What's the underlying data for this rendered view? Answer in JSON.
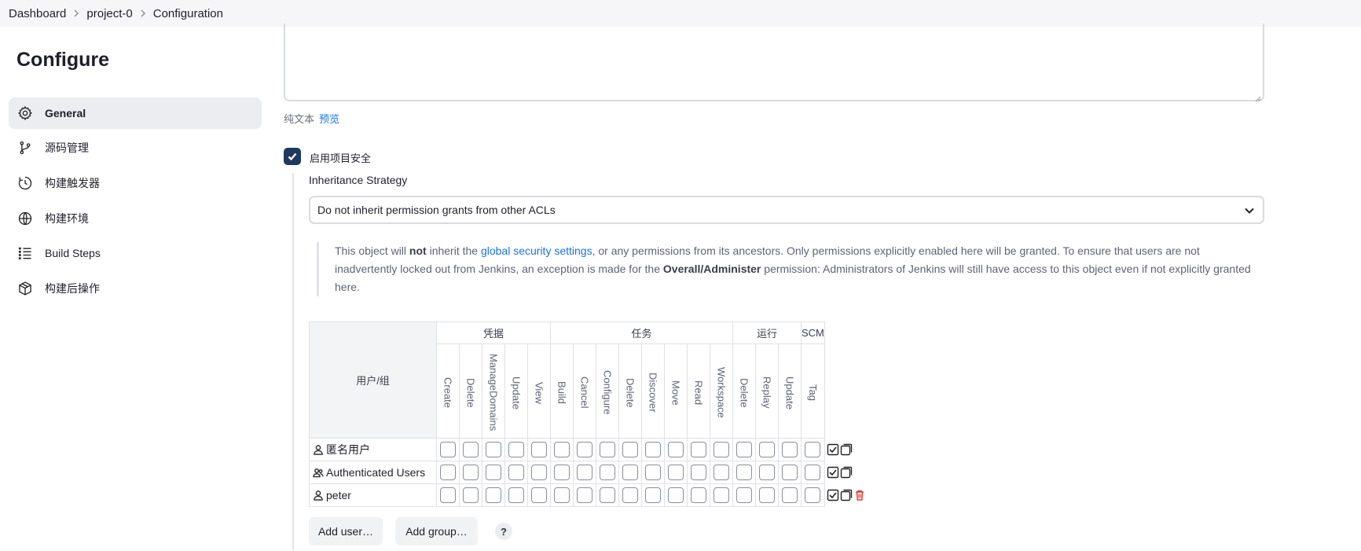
{
  "breadcrumb": [
    "Dashboard",
    "project-0",
    "Configuration"
  ],
  "sidebar": {
    "title": "Configure",
    "items": [
      {
        "label": "General",
        "icon": "gear-icon",
        "active": true
      },
      {
        "label": "源码管理",
        "icon": "branch-icon",
        "active": false
      },
      {
        "label": "构建触发器",
        "icon": "clock-icon",
        "active": false
      },
      {
        "label": "构建环境",
        "icon": "globe-icon",
        "active": false
      },
      {
        "label": "Build Steps",
        "icon": "list-icon",
        "active": false
      },
      {
        "label": "构建后操作",
        "icon": "package-icon",
        "active": false
      }
    ]
  },
  "description": {
    "plain_text_label": "纯文本",
    "preview_link": "预览"
  },
  "project_security": {
    "checkbox_label": "启用项目安全",
    "checked": true,
    "inheritance_label": "Inheritance Strategy",
    "inheritance_value": "Do not inherit permission grants from other ACLs",
    "note_part1": "This object will ",
    "note_bold1": "not",
    "note_part2": " inherit the ",
    "note_link": "global security settings",
    "note_part3": ", or any permissions from its ancestors. Only permissions explicitly enabled here will be granted. To ensure that users are not inadvertently locked out from Jenkins, an exception is made for the ",
    "note_bold2": "Overall/Administer",
    "note_part4": " permission: Administrators of Jenkins will still have access to this object even if not explicitly granted here."
  },
  "matrix": {
    "user_header": "用户/组",
    "groups": [
      {
        "name": "凭据",
        "perms": [
          "Create",
          "Delete",
          "ManageDomains",
          "Update",
          "View"
        ]
      },
      {
        "name": "任务",
        "perms": [
          "Build",
          "Cancel",
          "Configure",
          "Delete",
          "Discover",
          "Move",
          "Read",
          "Workspace"
        ]
      },
      {
        "name": "运行",
        "perms": [
          "Delete",
          "Replay",
          "Update"
        ]
      },
      {
        "name": "SCM",
        "perms": [
          "Tag"
        ]
      }
    ],
    "rows": [
      {
        "name": "匿名用户",
        "icon": "user-icon",
        "deletable": false
      },
      {
        "name": "Authenticated Users",
        "icon": "users-icon",
        "deletable": false
      },
      {
        "name": "peter",
        "icon": "user-icon",
        "deletable": true
      }
    ]
  },
  "buttons": {
    "add_user": "Add user…",
    "add_group": "Add group…",
    "help": "?"
  },
  "colors": {
    "accent": "#1e3a5f",
    "link": "#1a73e8",
    "danger": "#e53935"
  }
}
